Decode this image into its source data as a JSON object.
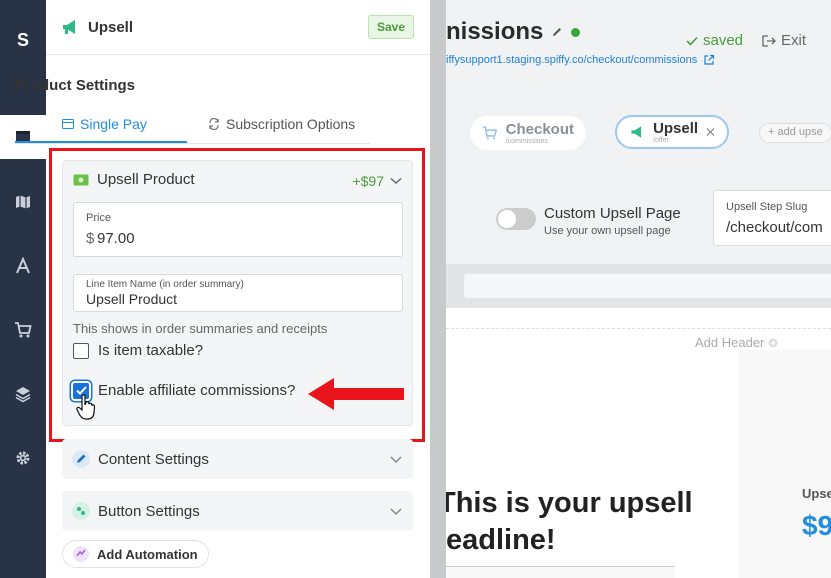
{
  "nav": {
    "logo": "S",
    "items": [
      "pages-icon",
      "map-icon",
      "typography-icon",
      "cart-icon",
      "layers-icon",
      "gear-icon"
    ]
  },
  "panel": {
    "title": "Upsell",
    "save_label": "Save",
    "section_title": "Product Settings",
    "tabs": [
      {
        "label": "Single Pay",
        "active": true
      },
      {
        "label": "Subscription Options",
        "active": false
      }
    ]
  },
  "product": {
    "header": "Upsell Product",
    "price_badge": "+$97",
    "price_label": "Price",
    "price_currency": "$",
    "price_value": "97.00",
    "line_item_label": "Line Item Name (in order summary)",
    "line_item_value": "Upsell Product",
    "note": "This shows in order summaries and receipts",
    "taxable_label": "Is item taxable?",
    "taxable_checked": false,
    "affiliate_label": "Enable affiliate commissions?",
    "affiliate_checked": true
  },
  "accordions": [
    {
      "label": "Content Settings"
    },
    {
      "label": "Button Settings"
    }
  ],
  "automation_label": "Add Automation",
  "preview": {
    "title": "nissions",
    "url": "iffysupport1.staging.spiffy.co/checkout/commissions",
    "saved_label": "saved",
    "exit_label": "Exit",
    "steps": [
      {
        "name": "Checkout",
        "sub": "/commissions"
      },
      {
        "name": "Upsell",
        "sub": "/offer"
      }
    ],
    "add_upsell": "+ add upse",
    "custom_page_title": "Custom Upsell Page",
    "custom_page_sub": "Use your own upsell page",
    "slug_label": "Upsell Step Slug",
    "slug_value": "/checkout/com",
    "add_header": "Add Header",
    "headline_line1": "This is your upsell",
    "headline_line2": "eadline!",
    "side_label": "Upse",
    "side_price": "$9"
  },
  "colors": {
    "nav_bg": "#283346",
    "accent_blue": "#1f8ee0",
    "green": "#4a9a3c",
    "annotation_red": "#e8131b"
  }
}
